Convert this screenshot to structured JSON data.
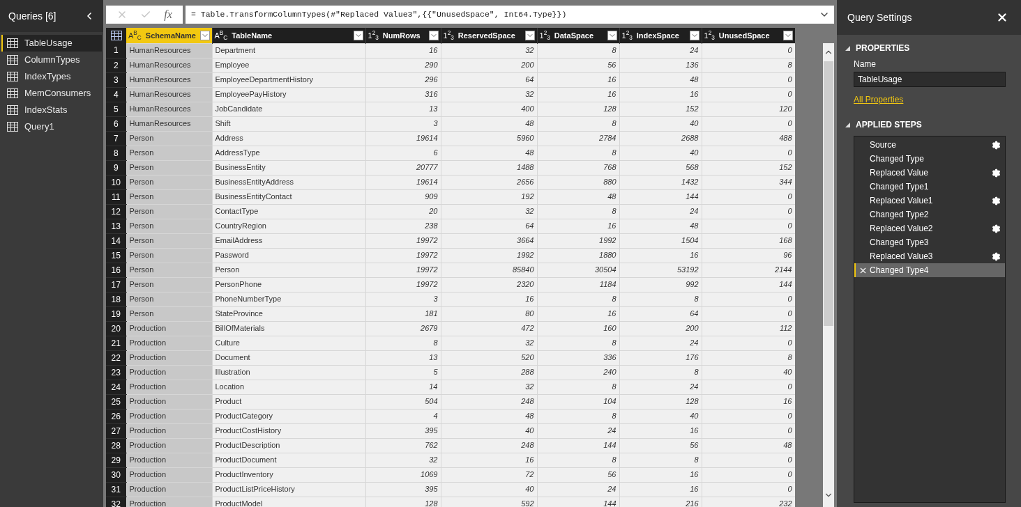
{
  "queries_panel": {
    "title": "Queries [6]",
    "items": [
      {
        "label": "TableUsage",
        "selected": true
      },
      {
        "label": "ColumnTypes",
        "selected": false
      },
      {
        "label": "IndexTypes",
        "selected": false
      },
      {
        "label": "MemConsumers",
        "selected": false
      },
      {
        "label": "IndexStats",
        "selected": false
      },
      {
        "label": "Query1",
        "selected": false
      }
    ]
  },
  "formula_bar": {
    "function_label": "fx",
    "formula": "= Table.TransformColumnTypes(#\"Replaced Value3\",{{\"UnusedSpace\", Int64.Type}})"
  },
  "table": {
    "columns": [
      {
        "type": "A$^{B}$$_{C}$",
        "name": "SchemaName",
        "selected": true,
        "kind": "text"
      },
      {
        "type": "A$^{B}$$_{C}$",
        "name": "TableName",
        "selected": false,
        "kind": "text"
      },
      {
        "type": "1$^{2}$$_{3}$",
        "name": "NumRows",
        "selected": false,
        "kind": "number"
      },
      {
        "type": "1$^{2}$$_{3}$",
        "name": "ReservedSpace",
        "selected": false,
        "kind": "number"
      },
      {
        "type": "1$^{2}$$_{3}$",
        "name": "DataSpace",
        "selected": false,
        "kind": "number"
      },
      {
        "type": "1$^{2}$$_{3}$",
        "name": "IndexSpace",
        "selected": false,
        "kind": "number"
      },
      {
        "type": "1$^{2}$$_{3}$",
        "name": "UnusedSpace",
        "selected": false,
        "kind": "number"
      }
    ],
    "rows": [
      {
        "number": "1",
        "cells": [
          "HumanResources",
          "Department",
          "16",
          "32",
          "8",
          "24",
          "0"
        ]
      },
      {
        "number": "2",
        "cells": [
          "HumanResources",
          "Employee",
          "290",
          "200",
          "56",
          "136",
          "8"
        ]
      },
      {
        "number": "3",
        "cells": [
          "HumanResources",
          "EmployeeDepartmentHistory",
          "296",
          "64",
          "16",
          "48",
          "0"
        ]
      },
      {
        "number": "4",
        "cells": [
          "HumanResources",
          "EmployeePayHistory",
          "316",
          "32",
          "16",
          "16",
          "0"
        ]
      },
      {
        "number": "5",
        "cells": [
          "HumanResources",
          "JobCandidate",
          "13",
          "400",
          "128",
          "152",
          "120"
        ]
      },
      {
        "number": "6",
        "cells": [
          "HumanResources",
          "Shift",
          "3",
          "48",
          "8",
          "40",
          "0"
        ]
      },
      {
        "number": "7",
        "cells": [
          "Person",
          "Address",
          "19614",
          "5960",
          "2784",
          "2688",
          "488"
        ]
      },
      {
        "number": "8",
        "cells": [
          "Person",
          "AddressType",
          "6",
          "48",
          "8",
          "40",
          "0"
        ]
      },
      {
        "number": "9",
        "cells": [
          "Person",
          "BusinessEntity",
          "20777",
          "1488",
          "768",
          "568",
          "152"
        ]
      },
      {
        "number": "10",
        "cells": [
          "Person",
          "BusinessEntityAddress",
          "19614",
          "2656",
          "880",
          "1432",
          "344"
        ]
      },
      {
        "number": "11",
        "cells": [
          "Person",
          "BusinessEntityContact",
          "909",
          "192",
          "48",
          "144",
          "0"
        ]
      },
      {
        "number": "12",
        "cells": [
          "Person",
          "ContactType",
          "20",
          "32",
          "8",
          "24",
          "0"
        ]
      },
      {
        "number": "13",
        "cells": [
          "Person",
          "CountryRegion",
          "238",
          "64",
          "16",
          "48",
          "0"
        ]
      },
      {
        "number": "14",
        "cells": [
          "Person",
          "EmailAddress",
          "19972",
          "3664",
          "1992",
          "1504",
          "168"
        ]
      },
      {
        "number": "15",
        "cells": [
          "Person",
          "Password",
          "19972",
          "1992",
          "1880",
          "16",
          "96"
        ]
      },
      {
        "number": "16",
        "cells": [
          "Person",
          "Person",
          "19972",
          "85840",
          "30504",
          "53192",
          "2144"
        ]
      },
      {
        "number": "17",
        "cells": [
          "Person",
          "PersonPhone",
          "19972",
          "2320",
          "1184",
          "992",
          "144"
        ]
      },
      {
        "number": "18",
        "cells": [
          "Person",
          "PhoneNumberType",
          "3",
          "16",
          "8",
          "8",
          "0"
        ]
      },
      {
        "number": "19",
        "cells": [
          "Person",
          "StateProvince",
          "181",
          "80",
          "16",
          "64",
          "0"
        ]
      },
      {
        "number": "20",
        "cells": [
          "Production",
          "BillOfMaterials",
          "2679",
          "472",
          "160",
          "200",
          "112"
        ]
      },
      {
        "number": "21",
        "cells": [
          "Production",
          "Culture",
          "8",
          "32",
          "8",
          "24",
          "0"
        ]
      },
      {
        "number": "22",
        "cells": [
          "Production",
          "Document",
          "13",
          "520",
          "336",
          "176",
          "8"
        ]
      },
      {
        "number": "23",
        "cells": [
          "Production",
          "Illustration",
          "5",
          "288",
          "240",
          "8",
          "40"
        ]
      },
      {
        "number": "24",
        "cells": [
          "Production",
          "Location",
          "14",
          "32",
          "8",
          "24",
          "0"
        ]
      },
      {
        "number": "25",
        "cells": [
          "Production",
          "Product",
          "504",
          "248",
          "104",
          "128",
          "16"
        ]
      },
      {
        "number": "26",
        "cells": [
          "Production",
          "ProductCategory",
          "4",
          "48",
          "8",
          "40",
          "0"
        ]
      },
      {
        "number": "27",
        "cells": [
          "Production",
          "ProductCostHistory",
          "395",
          "40",
          "24",
          "16",
          "0"
        ]
      },
      {
        "number": "28",
        "cells": [
          "Production",
          "ProductDescription",
          "762",
          "248",
          "144",
          "56",
          "48"
        ]
      },
      {
        "number": "29",
        "cells": [
          "Production",
          "ProductDocument",
          "32",
          "16",
          "8",
          "8",
          "0"
        ]
      },
      {
        "number": "30",
        "cells": [
          "Production",
          "ProductInventory",
          "1069",
          "72",
          "56",
          "16",
          "0"
        ]
      },
      {
        "number": "31",
        "cells": [
          "Production",
          "ProductListPriceHistory",
          "395",
          "40",
          "24",
          "16",
          "0"
        ]
      },
      {
        "number": "32",
        "cells": [
          "Production",
          "ProductModel",
          "128",
          "592",
          "144",
          "216",
          "232"
        ]
      }
    ]
  },
  "query_settings": {
    "title": "Query Settings",
    "properties": {
      "heading": "PROPERTIES",
      "name_label": "Name",
      "name_value": "TableUsage",
      "link": "All Properties"
    },
    "applied_steps": {
      "heading": "APPLIED STEPS",
      "steps": [
        {
          "label": "Source",
          "has_settings": true,
          "selected": false
        },
        {
          "label": "Changed Type",
          "has_settings": false,
          "selected": false
        },
        {
          "label": "Replaced Value",
          "has_settings": true,
          "selected": false
        },
        {
          "label": "Changed Type1",
          "has_settings": false,
          "selected": false
        },
        {
          "label": "Replaced Value1",
          "has_settings": true,
          "selected": false
        },
        {
          "label": "Changed Type2",
          "has_settings": false,
          "selected": false
        },
        {
          "label": "Replaced Value2",
          "has_settings": true,
          "selected": false
        },
        {
          "label": "Changed Type3",
          "has_settings": false,
          "selected": false
        },
        {
          "label": "Replaced Value3",
          "has_settings": true,
          "selected": false
        },
        {
          "label": "Changed Type4",
          "has_settings": false,
          "selected": true
        }
      ]
    }
  }
}
